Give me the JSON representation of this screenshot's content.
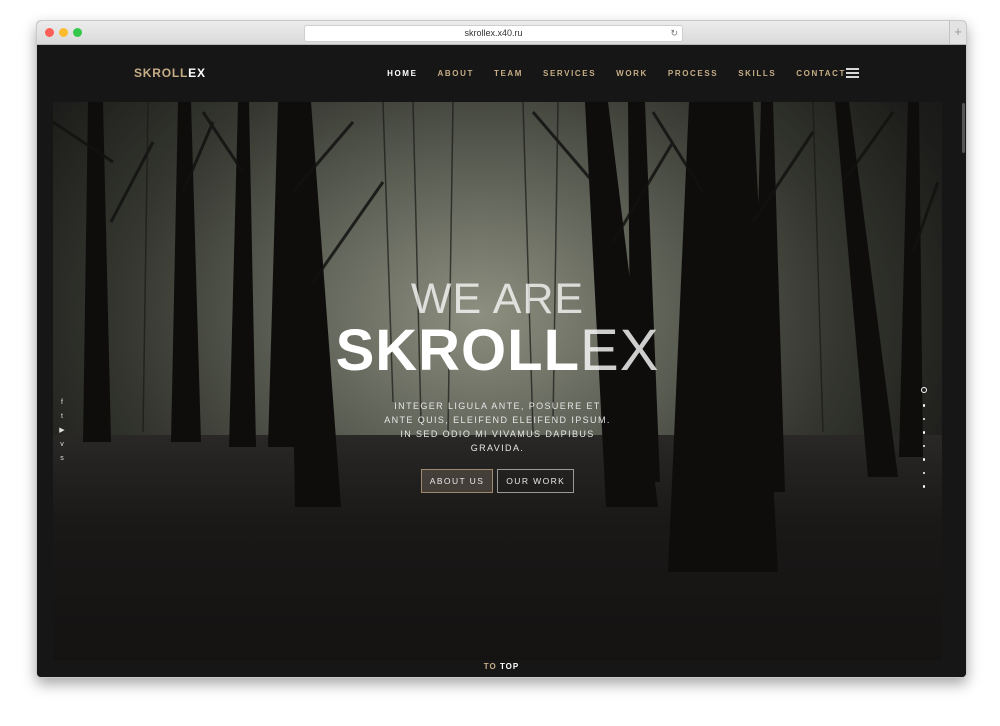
{
  "browser": {
    "url": "skrollex.x40.ru",
    "reload_icon": "↻",
    "new_tab_icon": "+",
    "traffic_lights": [
      "#fc5f57",
      "#fdbc2e",
      "#34c84a"
    ]
  },
  "nav": {
    "logo_part1": "SKROLL",
    "logo_part2": "EX",
    "items": [
      {
        "label": "HOME",
        "active": true
      },
      {
        "label": "ABOUT"
      },
      {
        "label": "TEAM"
      },
      {
        "label": "SERVICES"
      },
      {
        "label": "WORK"
      },
      {
        "label": "PROCESS"
      },
      {
        "label": "SKILLS"
      },
      {
        "label": "CONTACT"
      }
    ],
    "menu_icon": "hamburger-icon"
  },
  "hero": {
    "line1": "WE ARE",
    "brand_bold": "SKROLL",
    "brand_light": "EX",
    "lead": "INTEGER LIGULA ANTE, POSUERE ET ANTE QUIS, ELEIFEND ELEIFEND IPSUM. IN SED ODIO MI VIVAMUS DAPIBUS GRAVIDA.",
    "btn_about": "ABOUT US",
    "btn_work": "OUR WORK"
  },
  "social": [
    {
      "name": "facebook-icon",
      "glyph": "f"
    },
    {
      "name": "twitter-icon",
      "glyph": "t"
    },
    {
      "name": "youtube-icon",
      "glyph": "▶"
    },
    {
      "name": "vimeo-icon",
      "glyph": "v"
    },
    {
      "name": "skype-icon",
      "glyph": "s"
    }
  ],
  "footer": {
    "totop_1": "TO",
    "totop_2": "TOP"
  },
  "colors": {
    "accent": "#c7ad86",
    "background": "#161616"
  }
}
